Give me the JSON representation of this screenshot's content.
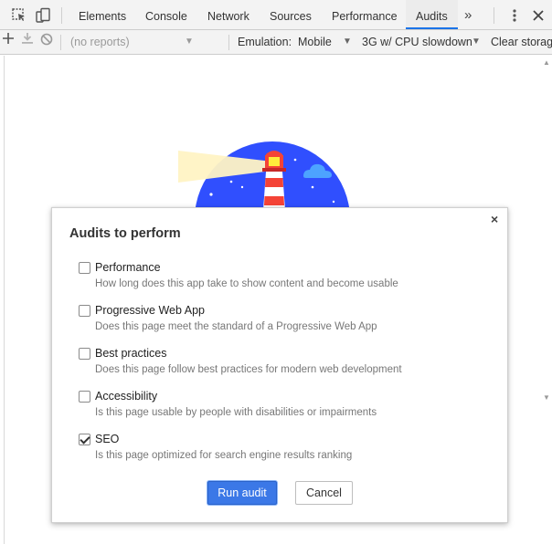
{
  "tabs": [
    {
      "label": "Elements"
    },
    {
      "label": "Console"
    },
    {
      "label": "Network"
    },
    {
      "label": "Sources"
    },
    {
      "label": "Performance"
    },
    {
      "label": "Audits",
      "active": true
    }
  ],
  "tab_overflow_glyph": "»",
  "toolbar": {
    "reports_placeholder": "(no reports)",
    "emulation_label": "Emulation:",
    "emulation_value": "Mobile",
    "throttling_value": "3G w/ CPU slowdown",
    "clear_storage_label": "Clear storage"
  },
  "dialog": {
    "title": "Audits to perform",
    "close_glyph": "×",
    "audits": [
      {
        "name": "Performance",
        "description": "How long does this app take to show content and become usable",
        "checked": false
      },
      {
        "name": "Progressive Web App",
        "description": "Does this page meet the standard of a Progressive Web App",
        "checked": false
      },
      {
        "name": "Best practices",
        "description": "Does this page follow best practices for modern web development",
        "checked": false
      },
      {
        "name": "Accessibility",
        "description": "Is this page usable by people with disabilities or impairments",
        "checked": false
      },
      {
        "name": "SEO",
        "description": "Is this page optimized for search engine results ranking",
        "checked": true
      }
    ],
    "run_label": "Run audit",
    "cancel_label": "Cancel"
  },
  "colors": {
    "accent": "#1a73e8",
    "primary_button": "#3b78e7",
    "hero_blue": "#304ffe",
    "lighthouse_red": "#f44336"
  },
  "icons": [
    "inspect-element-icon",
    "device-toolbar-icon",
    "more-tabs-icon",
    "kebab-menu-icon",
    "close-devtools-icon",
    "new-audit-plus-icon",
    "download-report-icon",
    "clear-block-icon",
    "dropdown-caret-icon",
    "lighthouse-logo",
    "close-dialog-icon",
    "checkbox-icon"
  ]
}
